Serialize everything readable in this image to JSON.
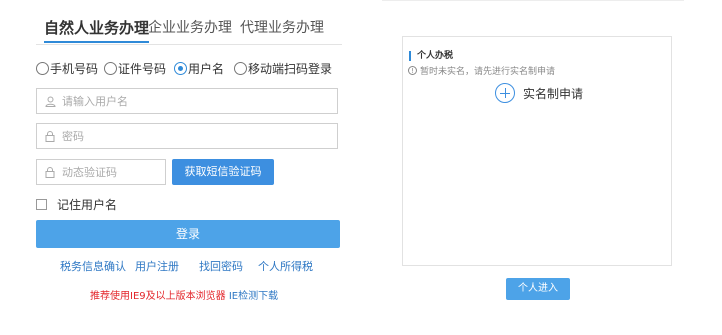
{
  "tabs": [
    {
      "label": "自然人业务办理",
      "active": true
    },
    {
      "label": "企业业务办理",
      "active": false
    },
    {
      "label": "代理业务办理",
      "active": false
    }
  ],
  "login_methods": [
    {
      "label": "手机号码",
      "selected": false
    },
    {
      "label": "证件号码",
      "selected": false
    },
    {
      "label": "用户名",
      "selected": true
    },
    {
      "label": "移动端扫码登录",
      "selected": false
    }
  ],
  "form": {
    "username": {
      "placeholder": "请输入用户名",
      "value": "",
      "icon": "user-icon"
    },
    "password": {
      "placeholder": "密码",
      "value": "",
      "icon": "lock-icon"
    },
    "sms_code": {
      "placeholder": "动态验证码",
      "value": "",
      "icon": "lock-icon"
    },
    "sms_button": "获取短信验证码",
    "remember_label": "记住用户名",
    "remember_checked": false,
    "login_button": "登录"
  },
  "links": [
    "税务信息确认",
    "用户注册",
    "找回密码",
    "个人所得税"
  ],
  "browser_note": {
    "text": "推荐使用IE9及以上版本浏览器",
    "link": "IE检测下载"
  },
  "personal_panel": {
    "title": "个人办税",
    "warning": "暂时未实名，请先进行实名制申请",
    "apply_label": "实名制申请",
    "enter_button": "个人进入"
  },
  "colors": {
    "accent": "#2f8ad8",
    "button": "#4da3e8",
    "note_red": "#e3262b"
  }
}
